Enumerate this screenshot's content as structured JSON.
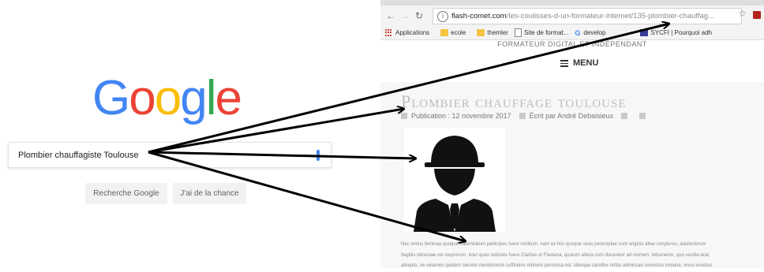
{
  "google": {
    "logo_letters": [
      {
        "ch": "G",
        "color": "#4285F4"
      },
      {
        "ch": "o",
        "color": "#EA4335"
      },
      {
        "ch": "o",
        "color": "#FBBC05"
      },
      {
        "ch": "g",
        "color": "#4285F4"
      },
      {
        "ch": "l",
        "color": "#34A853"
      },
      {
        "ch": "e",
        "color": "#EA4335"
      }
    ],
    "search_query": "Plombier chauffagiste Toulouse",
    "buttons": {
      "search": "Recherche Google",
      "lucky": "J'ai de la chance"
    }
  },
  "browser": {
    "url_host": "flash-comet.com",
    "url_path": "/les-coulisses-d-un-formateur-internet/135-plombier-chauffag...",
    "bookmarks": {
      "apps": "Applications",
      "ecole": "ecole",
      "themler": "themler",
      "site_format": "Site de format...",
      "develop": "develop",
      "sycfi": "SYCFI | Pourquoi adh"
    }
  },
  "site": {
    "tagline": "FORMATEUR DIGITAL ET INDÉPENDANT",
    "menu_label": "MENU",
    "post_title": "Plombier chauffage toulouse",
    "publication": "Publication : 12 novembre 2017",
    "author": "Écrit par André Debaisieux",
    "paragraph_lines": [
      "Nec minus feminae quoque calamitatum participes fuere similium. nam ex hoc quoque sexu peremptae sunt originis altae conplures, adulteriorum",
      "flagitiis obnoxiae vel stuprorum. inter quas notiores fuere Claritas et Flaviana, quarum altera cum duceretur ad mortem, indumento, quo vestita erat,",
      "abrepto, ne velamen quidem secreto membrorum sufficiens retinere permissa est. ideoque carnifex nefas admissae convictus inmane, vivus exustus"
    ]
  }
}
